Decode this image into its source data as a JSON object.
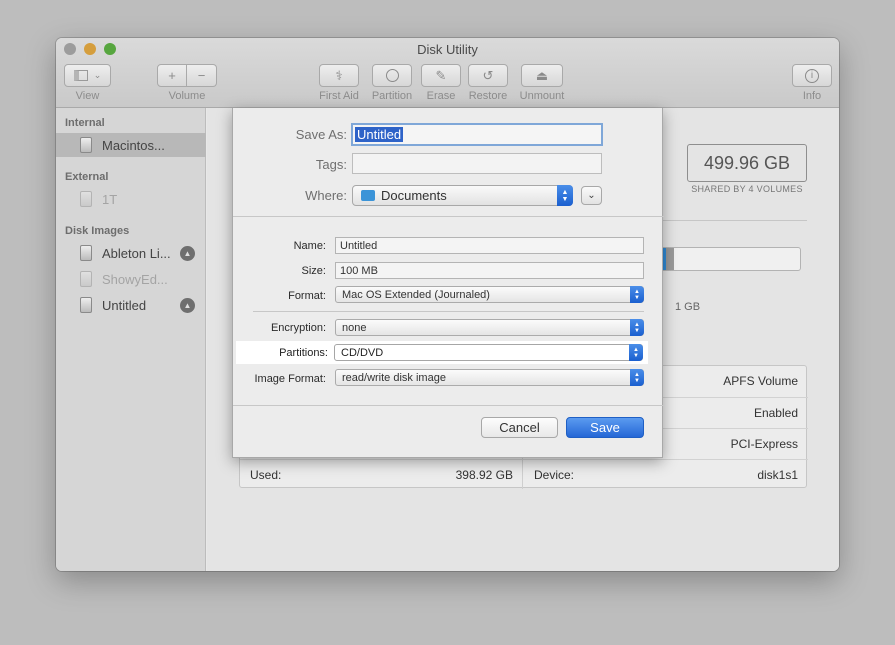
{
  "window": {
    "title": "Disk Utility"
  },
  "toolbar": {
    "view_label": "View",
    "volume_label": "Volume",
    "volume_add": "+",
    "volume_remove": "−",
    "first_aid_label": "First Aid",
    "partition_label": "Partition",
    "erase_label": "Erase",
    "restore_label": "Restore",
    "unmount_label": "Unmount",
    "info_label": "Info"
  },
  "sidebar": {
    "internal_header": "Internal",
    "internal_items": [
      {
        "label": "Macintos..."
      }
    ],
    "external_header": "External",
    "external_items": [
      {
        "label": "1T"
      }
    ],
    "disk_images_header": "Disk Images",
    "disk_image_items": [
      {
        "label": "Ableton Li..."
      },
      {
        "label": "ShowyEd..."
      },
      {
        "label": "Untitled"
      }
    ]
  },
  "main": {
    "capacity": "499.96 GB",
    "shared_text": "SHARED BY 4 VOLUMES",
    "usage_fraction": 0.22,
    "gb_fragment": "1 GB",
    "info_rows": [
      {
        "left_label": "",
        "left_value": "",
        "right_label": "",
        "right_value": "APFS Volume"
      },
      {
        "left_label": "",
        "left_value": "",
        "right_label": "",
        "right_value": "Enabled"
      },
      {
        "left_label": "",
        "left_value": "",
        "right_label": "",
        "right_value": "PCI-Express"
      },
      {
        "left_label": "Used:",
        "left_value": "398.92 GB",
        "right_label": "Device:",
        "right_value": "disk1s1"
      }
    ]
  },
  "save_dialog": {
    "save_as_label": "Save As:",
    "save_as_value": "Untitled",
    "tags_label": "Tags:",
    "tags_value": "",
    "where_label": "Where:",
    "where_value": "Documents",
    "name_label": "Name:",
    "name_value": "Untitled",
    "size_label": "Size:",
    "size_value": "100 MB",
    "format_label": "Format:",
    "format_value": "Mac OS Extended (Journaled)",
    "encryption_label": "Encryption:",
    "encryption_value": "none",
    "partitions_label": "Partitions:",
    "partitions_value": "CD/DVD",
    "image_format_label": "Image Format:",
    "image_format_value": "read/write disk image",
    "cancel_label": "Cancel",
    "save_label": "Save"
  }
}
